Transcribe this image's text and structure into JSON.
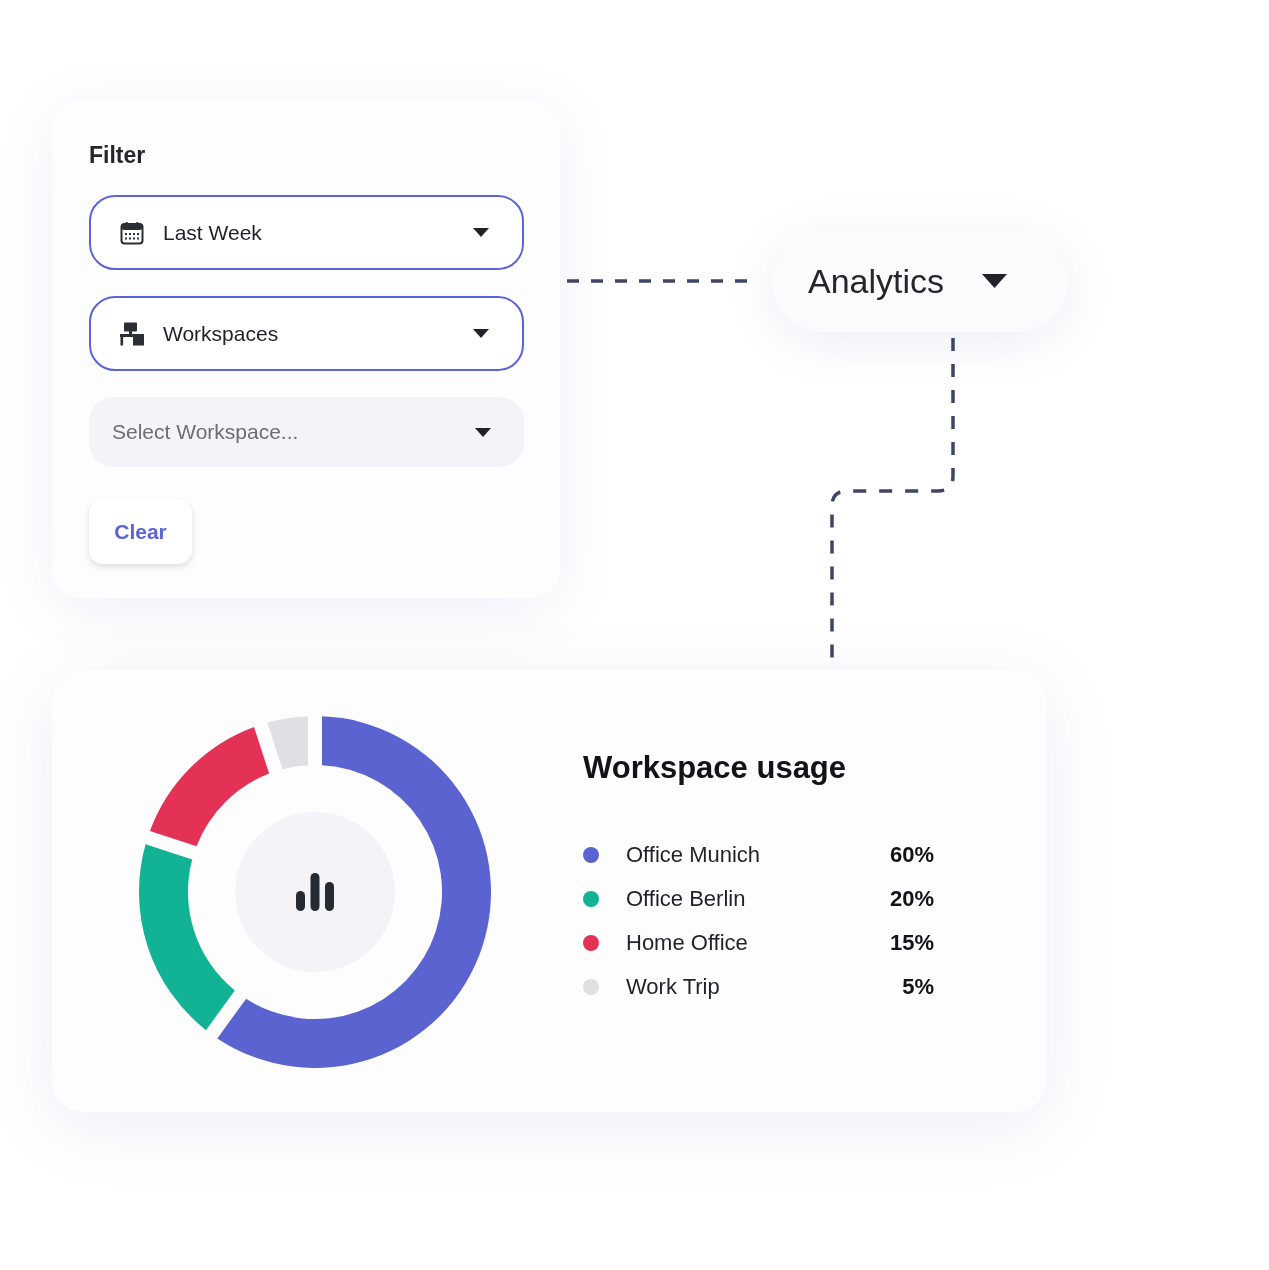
{
  "filter": {
    "title": "Filter",
    "dropdowns": [
      {
        "kind": "date",
        "value": "Last Week"
      },
      {
        "kind": "workspace",
        "value": "Workspaces"
      },
      {
        "kind": "select",
        "placeholder": "Select Workspace..."
      }
    ],
    "clear_button": "Clear"
  },
  "analytics_menu": {
    "label": "Analytics"
  },
  "usage": {
    "title": "Workspace usage",
    "legend": [
      {
        "name": "Office Munich",
        "value": "60%",
        "color": "#5b63d0"
      },
      {
        "name": "Office Berlin",
        "value": "20%",
        "color": "#12b394"
      },
      {
        "name": "Home Office",
        "value": "15%",
        "color": "#e33256"
      },
      {
        "name": "Work Trip",
        "value": "5%",
        "color": "#e0dfe3"
      }
    ],
    "chart_data": {
      "type": "donut",
      "values": [
        60,
        20,
        15,
        5
      ]
    }
  }
}
